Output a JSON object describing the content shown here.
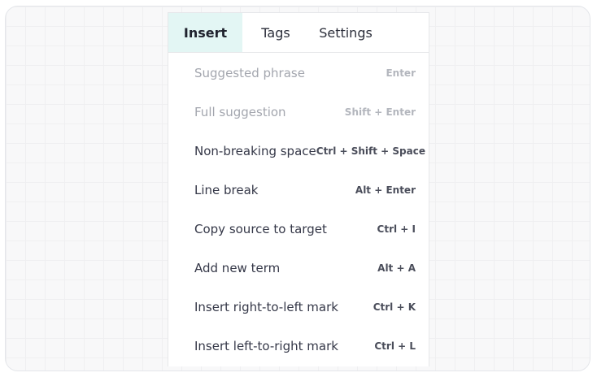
{
  "tabs": [
    {
      "label": "Insert",
      "active": true
    },
    {
      "label": "Tags",
      "active": false
    },
    {
      "label": "Settings",
      "active": false
    }
  ],
  "items": [
    {
      "label": "Suggested phrase",
      "shortcut": "Enter",
      "disabled": true
    },
    {
      "label": "Full suggestion",
      "shortcut": "Shift + Enter",
      "disabled": true
    },
    {
      "label": "Non-breaking space",
      "shortcut": "Ctrl + Shift + Space",
      "disabled": false
    },
    {
      "label": "Line break",
      "shortcut": "Alt + Enter",
      "disabled": false
    },
    {
      "label": "Copy source to target",
      "shortcut": "Ctrl + I",
      "disabled": false
    },
    {
      "label": "Add new term",
      "shortcut": "Alt + A",
      "disabled": false
    },
    {
      "label": "Insert right-to-left mark",
      "shortcut": "Ctrl + K",
      "disabled": false
    },
    {
      "label": "Insert left-to-right mark",
      "shortcut": "Ctrl + L",
      "disabled": false
    }
  ],
  "colors": {
    "active_tab_bg": "#e3f6f4",
    "text": "#353848",
    "disabled_text": "#a3a6ae"
  }
}
